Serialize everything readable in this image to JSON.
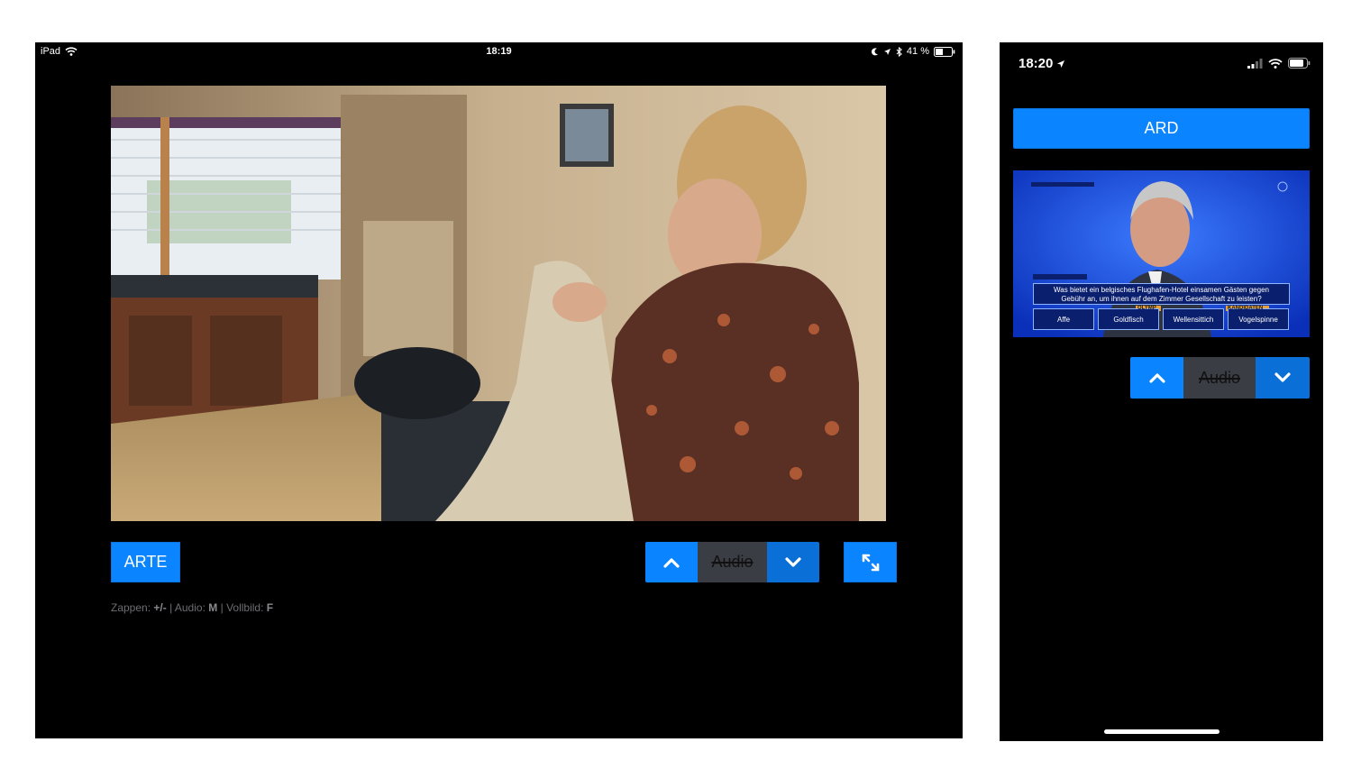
{
  "ipad": {
    "status": {
      "device": "iPad",
      "time": "18:19",
      "battery": "41 %"
    },
    "channel_label": "ARTE",
    "audio_label": "Audio",
    "icons": {
      "up": "chevron-up-icon",
      "down": "chevron-down-icon",
      "fullscreen": "expand-icon"
    },
    "hint": {
      "zappen_label": "Zappen:",
      "zappen_key": "+/-",
      "sep1": "|",
      "audio_label": "Audio:",
      "audio_key": "M",
      "sep2": "|",
      "vollbild_label": "Vollbild:",
      "vollbild_key": "F"
    }
  },
  "iphone": {
    "status": {
      "time": "18:20"
    },
    "channel_label": "ARD",
    "audio_label": "Audio",
    "quiz": {
      "question_line1": "Was bietet ein belgisches Flughafen-Hotel einsamen Gästen gegen",
      "question_line2": "Gebühr an, um ihnen auf dem Zimmer Gesellschaft zu leisten?",
      "answers": [
        "Affe",
        "Goldfisch",
        "Wellensittich",
        "Vogelspinne"
      ],
      "label_olymp": "OLYMP",
      "label_kandidaten": "KANDIDATEN"
    }
  },
  "colors": {
    "accent": "#0a84ff",
    "accent_dark": "#0a6fd6",
    "audio_muted_bg": "#3a3d44"
  }
}
